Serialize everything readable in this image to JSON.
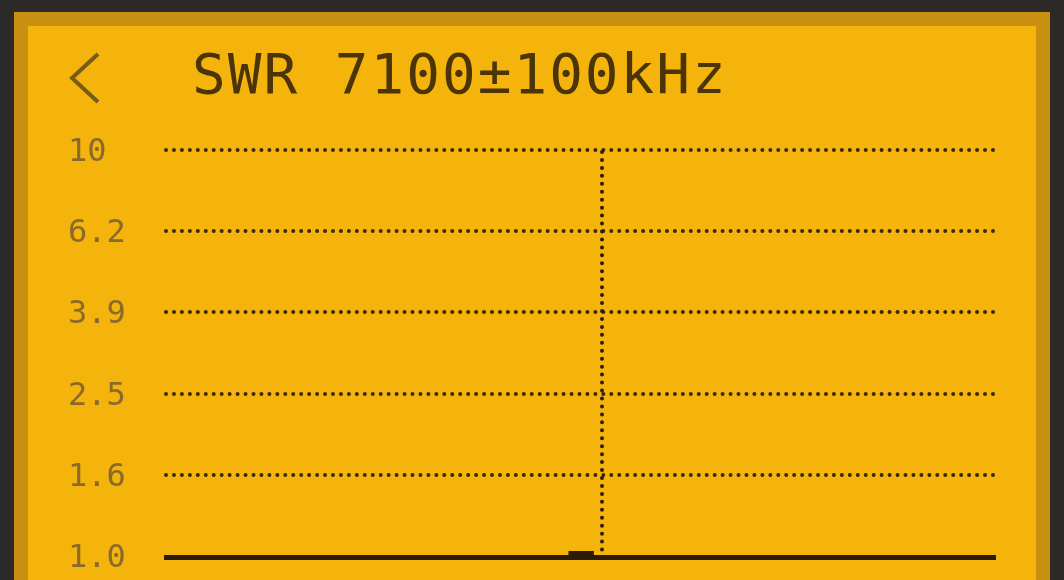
{
  "screen": {
    "title": "SWR 7100±100kHz",
    "y_labels": [
      "10",
      "6.2",
      "3.9",
      "2.5",
      "1.6",
      "1.0"
    ]
  }
}
